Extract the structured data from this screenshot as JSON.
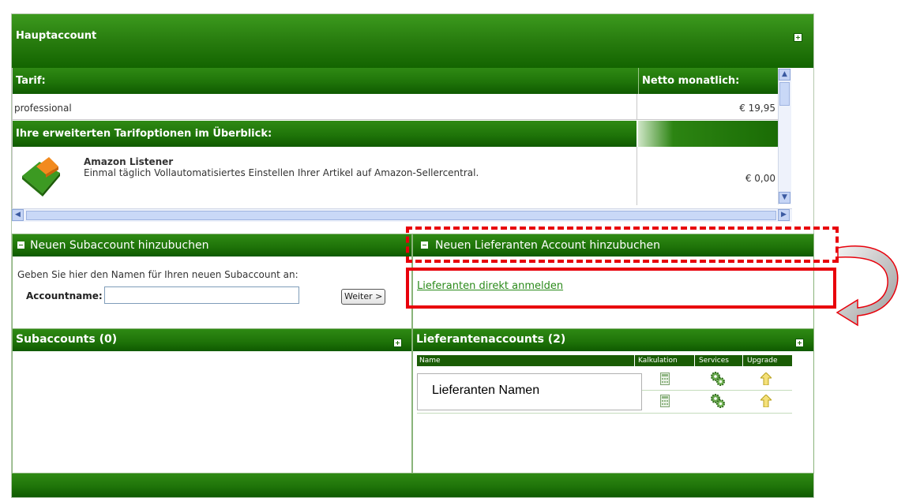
{
  "main": {
    "title": "Hauptaccount",
    "tariff_header": "Tarif:",
    "netto_header": "Netto monatlich:",
    "tariff_value": "professional",
    "tariff_price": "€ 19,95",
    "options_header": "Ihre erweiterten Tarifoptionen im Überblick:",
    "option_name": "Amazon Listener",
    "option_desc": "Einmal täglich Vollautomatisiertes Einstellen Ihrer Artikel auf Amazon-Sellercentral.",
    "option_price": "€ 0,00"
  },
  "subaccount_form": {
    "title": "Neuen Subaccount hinzubuchen",
    "instruction": "Geben Sie hier den Namen für Ihren neuen Subaccount an:",
    "label": "Accountname:",
    "input_value": "",
    "button": "Weiter >"
  },
  "supplier_form": {
    "title": "Neuen Lieferanten Account hinzubuchen",
    "link": "Lieferanten direkt anmelden"
  },
  "subaccounts": {
    "title": "Subaccounts (0)"
  },
  "supplier_accounts": {
    "title": "Lieferantenaccounts (2)",
    "columns": [
      "Name",
      "Kalkulation",
      "Services",
      "Upgrade"
    ],
    "annotation": "Lieferanten Namen"
  },
  "colors": {
    "accent_green": "#1f7409",
    "annotation_red": "#e8000b",
    "link_green": "#2a8a1a"
  },
  "icons": [
    "calculator-icon",
    "gears-icon",
    "upgrade-arrow-icon"
  ]
}
